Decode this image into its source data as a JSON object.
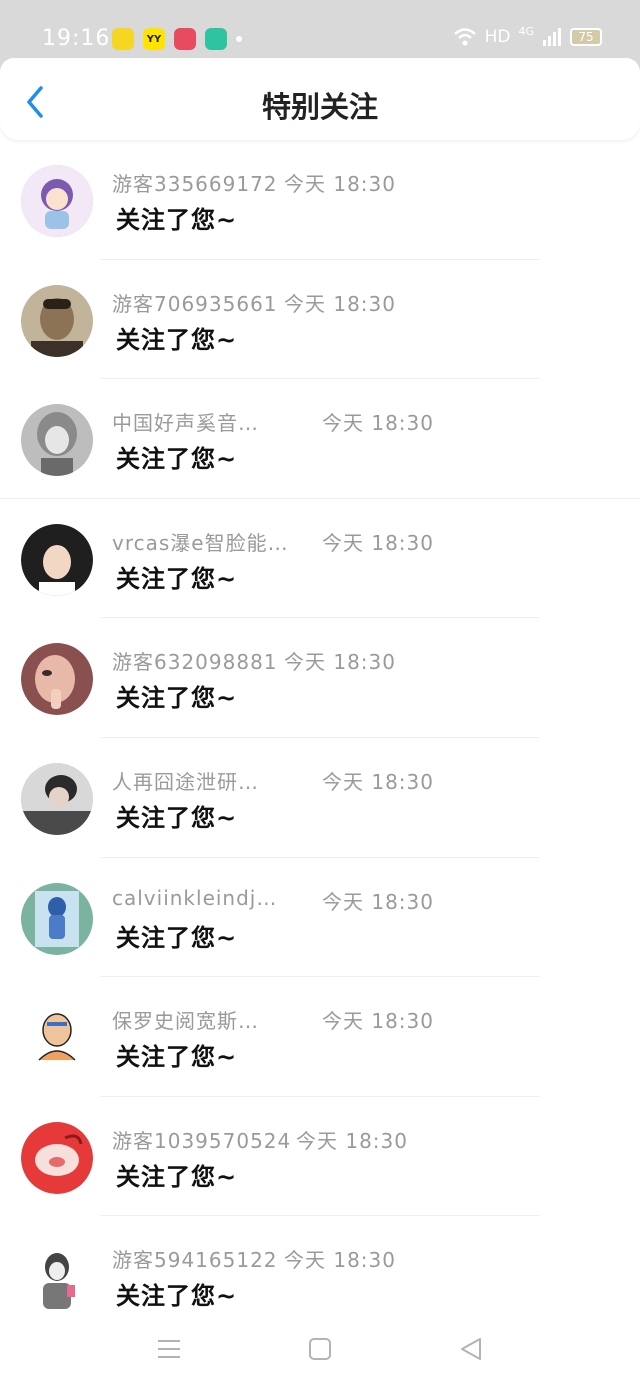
{
  "status_bar": {
    "time": "19:16",
    "network": "HD",
    "signal": "4G",
    "battery": "75",
    "apps": [
      {
        "name": "yellow-app",
        "label": "",
        "color": "#f5d623"
      },
      {
        "name": "yy-app",
        "label": "YY",
        "color": "#ffe400"
      },
      {
        "name": "video-app",
        "label": "",
        "color": "#e84a5f"
      },
      {
        "name": "green-app",
        "label": "",
        "color": "#2ec4a0"
      }
    ]
  },
  "header": {
    "title": "特别关注"
  },
  "items": [
    {
      "name": "游客335669172",
      "time": "今天 18:30",
      "message": "关注了您~",
      "avatar_color": "#d6b8e8"
    },
    {
      "name": "游客706935661",
      "time": "今天 18:30",
      "message": "关注了您~",
      "avatar_color": "#7a6a52"
    },
    {
      "name": "中国好声奚音…",
      "time": "今天 18:30",
      "message": "关注了您~",
      "avatar_color": "#9a9a9a"
    },
    {
      "name": "vrcas瀑e智脸能…",
      "time": "今天 18:30",
      "message": "关注了您~",
      "avatar_color": "#3a3a3a"
    },
    {
      "name": "游客632098881",
      "time": "今天 18:30",
      "message": "关注了您~",
      "avatar_color": "#b67a7a"
    },
    {
      "name": "人再囧途泄研…",
      "time": "今天 18:30",
      "message": "关注了您~",
      "avatar_color": "#6a6a6a"
    },
    {
      "name": "calviinkleindj…",
      "time": "今天 18:30",
      "message": "关注了您~",
      "avatar_color": "#5a8ab8"
    },
    {
      "name": "保罗史阅宽斯…",
      "time": "今天 18:30",
      "message": "关注了您~",
      "avatar_color": "#f3e4c8"
    },
    {
      "name": "游客1039570524",
      "time": "今天 18:30",
      "message": "关注了您~",
      "avatar_color": "#e63a3a"
    },
    {
      "name": "游客594165122",
      "time": "今天 18:30",
      "message": "关注了您~",
      "avatar_color": "#cccccc"
    }
  ]
}
